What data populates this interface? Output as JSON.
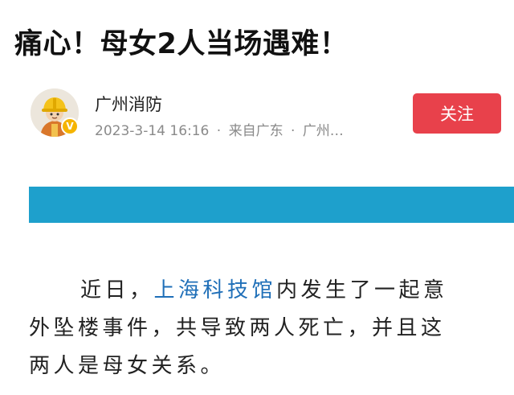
{
  "article": {
    "title": "痛心！母女2人当场遇难！"
  },
  "author": {
    "name": "广州消防",
    "date": "2023-3-14 16:16",
    "separator": "·",
    "source": "来自广东",
    "location": "广州…",
    "verify_badge": "V",
    "avatar_icon": "firefighter-avatar-icon"
  },
  "follow": {
    "label": "关注"
  },
  "colors": {
    "follow_button": "#e8414b",
    "banner": "#1ea0cc",
    "link": "#1f6fb8",
    "verify_badge": "#f5b400"
  },
  "body": {
    "line1_prefix": "近日，",
    "line1_link": "上海科技馆",
    "line1_suffix": "内发生了一起意",
    "line2": "外坠楼事件，共导致两人死亡，并且这",
    "line3": "两人是母女关系。"
  }
}
